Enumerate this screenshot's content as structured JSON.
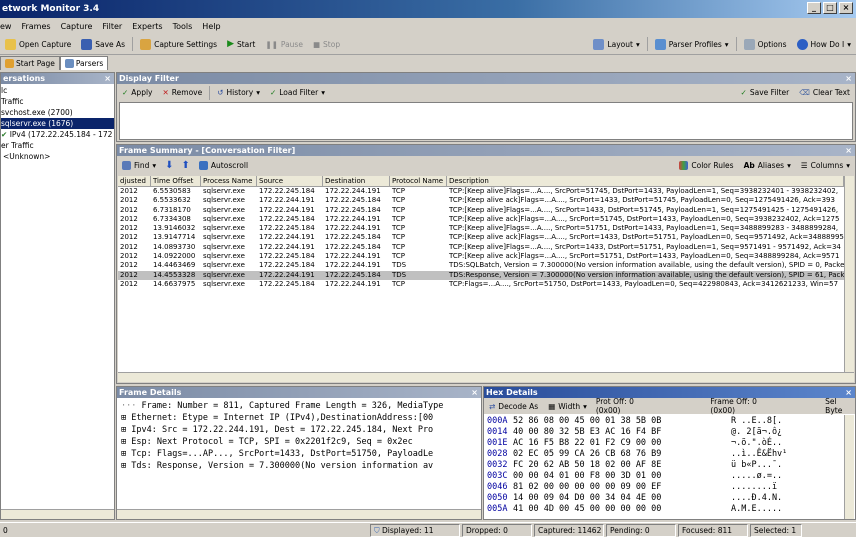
{
  "window": {
    "title": "etwork Monitor 3.4"
  },
  "menu": [
    "ew",
    "Frames",
    "Capture",
    "Filter",
    "Experts",
    "Tools",
    "Help"
  ],
  "toolbar": {
    "open_capture": "Open Capture",
    "save_as": "Save As",
    "capture_settings": "Capture Settings",
    "start": "Start",
    "pause": "Pause",
    "stop": "Stop",
    "layout": "Layout",
    "parser_profiles": "Parser Profiles",
    "options": "Options",
    "how_do_i": "How Do I"
  },
  "tabs": {
    "start_page": "Start Page",
    "parsers": "Parsers"
  },
  "conversations": {
    "title": "ersations",
    "items": [
      "lc",
      "Traffic",
      "svchost.exe (2700)",
      "sqlservr.exe (1676)",
      "IPv4 (172.22.245.184 - 172",
      "er Traffic",
      "<Unknown>"
    ]
  },
  "display_filter": {
    "title": "Display Filter",
    "apply": "Apply",
    "remove": "Remove",
    "history": "History",
    "load_filter": "Load Filter",
    "save_filter": "Save Filter",
    "clear_text": "Clear Text"
  },
  "frame_summary": {
    "title": "Frame Summary - [Conversation Filter]",
    "find": "Find",
    "autoscroll": "Autoscroll",
    "color_rules": "Color Rules",
    "aliases": "Aliases",
    "columns": "Columns",
    "headers": [
      "djusted",
      "Time Offset",
      "Process Name",
      "Source",
      "Destination",
      "Protocol Name",
      "Description"
    ],
    "rows": [
      [
        "2012",
        "6.5530583",
        "sqlservr.exe",
        "172.22.245.184",
        "172.22.244.191",
        "TCP",
        "TCP:[Keep alive]Flags=...A...., SrcPort=51745, DstPort=1433, PayloadLen=1, Seq=3938232401 - 3938232402,"
      ],
      [
        "2012",
        "6.5533632",
        "sqlservr.exe",
        "172.22.244.191",
        "172.22.245.184",
        "TCP",
        "TCP:[Keep alive ack]Flags=...A...., SrcPort=1433, DstPort=51745, PayloadLen=0, Seq=1275491426, Ack=393"
      ],
      [
        "2012",
        "6.7318170",
        "sqlservr.exe",
        "172.22.244.191",
        "172.22.245.184",
        "TCP",
        "TCP:[Keep alive]Flags=...A...., SrcPort=1433, DstPort=51745, PayloadLen=1, Seq=1275491425 - 1275491426,"
      ],
      [
        "2012",
        "6.7334308",
        "sqlservr.exe",
        "172.22.245.184",
        "172.22.244.191",
        "TCP",
        "TCP:[Keep alive ack]Flags=...A...., SrcPort=51745, DstPort=1433, PayloadLen=0, Seq=3938232402, Ack=1275"
      ],
      [
        "2012",
        "13.9146032",
        "sqlservr.exe",
        "172.22.245.184",
        "172.22.244.191",
        "TCP",
        "TCP:[Keep alive]Flags=...A...., SrcPort=51751, DstPort=1433, PayloadLen=1, Seq=3488899283 - 3488899284,"
      ],
      [
        "2012",
        "13.9147714",
        "sqlservr.exe",
        "172.22.244.191",
        "172.22.245.184",
        "TCP",
        "TCP:[Keep alive ack]Flags=...A...., SrcPort=1433, DstPort=51751, PayloadLen=0, Seq=9571492, Ack=34888995"
      ],
      [
        "2012",
        "14.0893730",
        "sqlservr.exe",
        "172.22.244.191",
        "172.22.245.184",
        "TCP",
        "TCP:[Keep alive]Flags=...A...., SrcPort=1433, DstPort=51751, PayloadLen=1, Seq=9571491 - 9571492, Ack=34"
      ],
      [
        "2012",
        "14.0922000",
        "sqlservr.exe",
        "172.22.245.184",
        "172.22.244.191",
        "TCP",
        "TCP:[Keep alive ack]Flags=...A...., SrcPort=51751, DstPort=1433, PayloadLen=0, Seq=3488899284, Ack=9571"
      ],
      [
        "2012",
        "14.4463469",
        "sqlservr.exe",
        "172.22.245.184",
        "172.22.244.191",
        "TDS",
        "TDS:SQLBatch, Version = 7.300000(No version information available, using the default version), SPID = 0, Packet"
      ],
      [
        "2012",
        "14.4553328",
        "sqlservr.exe",
        "172.22.244.191",
        "172.22.245.184",
        "TDS",
        "TDS:Response, Version = 7.300000(No version information available, using the default version), SPID = 61, Pack"
      ],
      [
        "2012",
        "14.6637975",
        "sqlservr.exe",
        "172.22.245.184",
        "172.22.244.191",
        "TCP",
        "TCP:Flags=...A...., SrcPort=51750, DstPort=1433, PayloadLen=0, Seq=422980843, Ack=3412621233, Win=57"
      ]
    ]
  },
  "frame_details": {
    "title": "Frame Details",
    "lines": [
      "Frame: Number = 811, Captured Frame Length = 326, MediaType",
      "Ethernet: Etype = Internet IP (IPv4),DestinationAddress:[00",
      "Ipv4: Src = 172.22.244.191, Dest = 172.22.245.184, Next Pro",
      "Esp: Next Protocol = TCP, SPI = 0x2201f2c9, Seq = 0x2ec",
      "Tcp: Flags=...AP..., SrcPort=1433, DstPort=51750, PayloadLe",
      "Tds: Response, Version = 7.300000(No version information av"
    ]
  },
  "hex_details": {
    "title": "Hex Details",
    "decode_as": "Decode As",
    "width": "Width",
    "prot_off": "Prot Off: 0 (0x00)",
    "frame_off": "Frame Off: 0 (0x00)",
    "sel_bytes": "Sel Byte",
    "rows": [
      [
        "000A",
        "52 86 08 00 45 00 01 38 5B 0B",
        "R ..E..8[."
      ],
      [
        "0014",
        "40 00 80 32 5B E3 AC 16 F4 BF",
        "@. 2[ã¬.ô¿"
      ],
      [
        "001E",
        "AC 16 F5 B8 22 01 F2 C9 00 00",
        "¬.õ.\".òÉ.."
      ],
      [
        "0028",
        "02 EC 05 99 CA 26 CB 68 76 B9",
        "..ì..Ê&Ëhv¹"
      ],
      [
        "0032",
        "FC 20 62 AB 50 18 02 00 AF 8E",
        "ü b«P...¯."
      ],
      [
        "003C",
        "00 00 04 01 00 F8 00 3D 01 00",
        ".....ø.=.."
      ],
      [
        "0046",
        "81 02 00 00 00 00 00 09 00 EF",
        "........ï"
      ],
      [
        "0050",
        "14 00 09 04 D0 00 34 04 4E 00",
        "....Ð.4.N."
      ],
      [
        "005A",
        "41 00 4D 00 45 00 00 00 00 00",
        "A.M.E....."
      ]
    ]
  },
  "statusbar": {
    "left": "0",
    "displayed": "Displayed: 11",
    "dropped": "Dropped: 0",
    "captured": "Captured: 11462",
    "pending": "Pending: 0",
    "focused": "Focused: 811",
    "selected": "Selected: 1"
  }
}
